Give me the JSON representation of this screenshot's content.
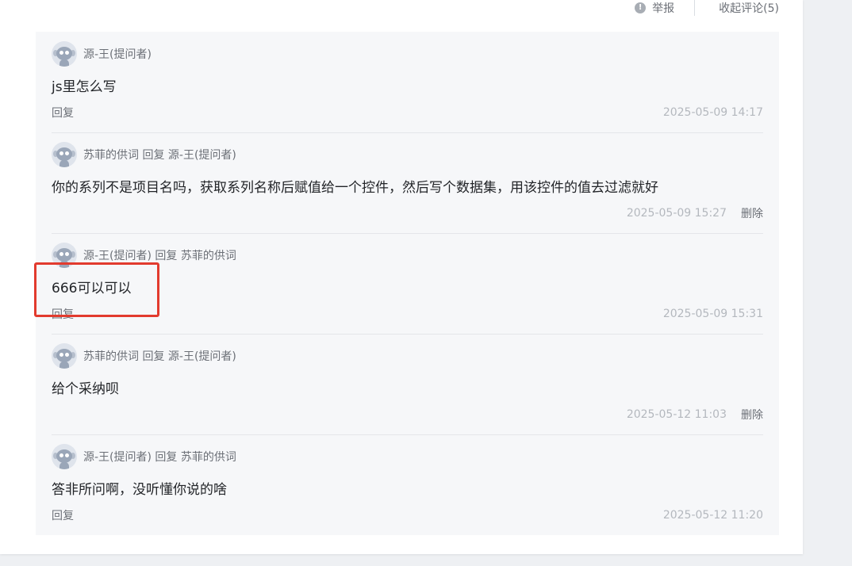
{
  "topbar": {
    "report_label": "举报",
    "collapse_label": "收起评论(5)"
  },
  "comments": [
    {
      "author": "源-王(提问者)",
      "text": "js里怎么写",
      "action": "回复",
      "time": "2025-05-09 14:17"
    },
    {
      "author": "苏菲的供词 回复 源-王(提问者)",
      "text": "你的系列不是项目名吗，获取系列名称后赋值给一个控件，然后写个数据集，用该控件的值去过滤就好",
      "action": "",
      "time": "2025-05-09 15:27",
      "delete": "删除"
    },
    {
      "author": "源-王(提问者) 回复 苏菲的供词",
      "text": "666可以可以",
      "action": "回复",
      "time": "2025-05-09 15:31"
    },
    {
      "author": "苏菲的供词 回复 源-王(提问者)",
      "text": "给个采纳呗",
      "action": "",
      "time": "2025-05-12 11:03",
      "delete": "删除"
    },
    {
      "author": "源-王(提问者) 回复 苏菲的供词",
      "text": "答非所问啊，没听懂你说的啥",
      "action": "回复",
      "time": "2025-05-12 11:20"
    }
  ],
  "colors": {
    "highlight": "#e23b2e",
    "panel": "#f6f7f9",
    "time": "#b4b8be"
  }
}
